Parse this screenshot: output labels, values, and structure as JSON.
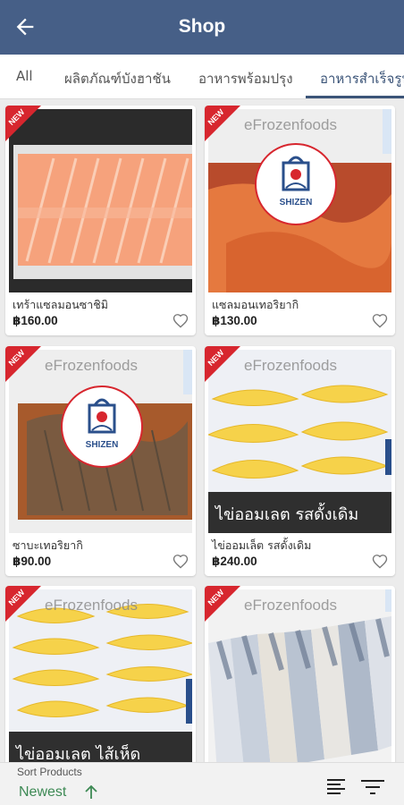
{
  "header": {
    "title": "Shop",
    "back_icon": "arrow-left-icon"
  },
  "tabs": [
    {
      "label": "All",
      "active": false
    },
    {
      "label": "ผลิตภัณฑ์บังฮาชัน",
      "active": false
    },
    {
      "label": "อาหารพร้อมปรุง",
      "active": false
    },
    {
      "label": "อาหารสำเร็จรูป",
      "active": true
    }
  ],
  "products": [
    {
      "name": "เทร้าแซลมอนซาชิมิ",
      "price": "฿160.00",
      "badge": "NEW",
      "caption": ""
    },
    {
      "name": "แซลมอนเทอริยากิ",
      "price": "฿130.00",
      "badge": "NEW",
      "caption": ""
    },
    {
      "name": "ซาบะเทอริยากิ",
      "price": "฿90.00",
      "badge": "NEW",
      "caption": ""
    },
    {
      "name": "ไข่ออมเล็ต รสดั้งเดิม",
      "price": "฿240.00",
      "badge": "NEW",
      "caption": "ไข่ออมเลต รสดั้งเดิม"
    },
    {
      "name": "",
      "price": "",
      "badge": "NEW",
      "caption": "ไข่ออมเลต ไส้เห็ด"
    },
    {
      "name": "",
      "price": "",
      "badge": "NEW",
      "caption": ""
    }
  ],
  "watermark": "eFrozenfoods",
  "logo_brand": "SHIZEN",
  "sort": {
    "label": "Sort Products",
    "value": "Newest"
  },
  "colors": {
    "appbar": "#465f87",
    "accent": "#3b5478",
    "sort_value": "#3e8a55",
    "badge": "#d7262e"
  }
}
